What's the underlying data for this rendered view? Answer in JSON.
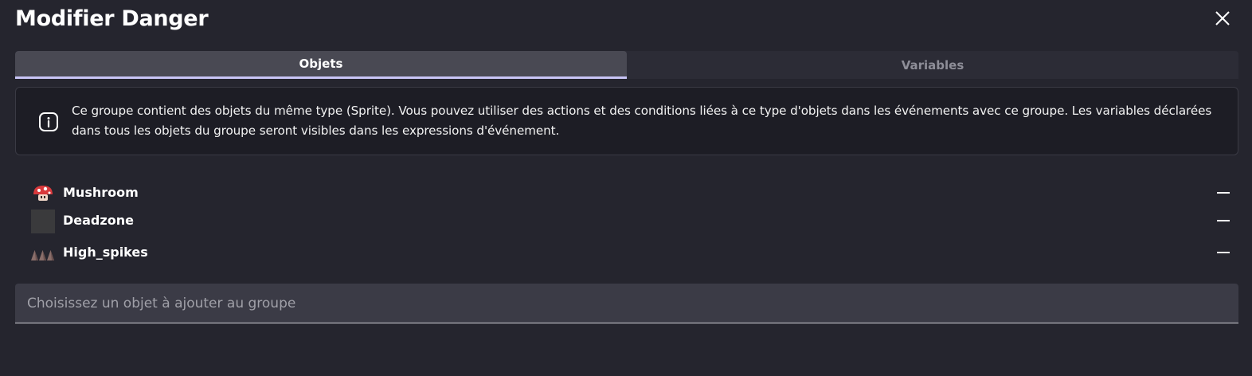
{
  "dialog": {
    "title": "Modifier Danger",
    "close_icon": "close-icon"
  },
  "tabs": [
    {
      "label": "Objets",
      "active": true
    },
    {
      "label": "Variables",
      "active": false
    }
  ],
  "info": {
    "icon": "info-icon",
    "text": "Ce groupe contient des objets du même type (Sprite). Vous pouvez utiliser des actions et des conditions liées à ce type d'objets dans les événements avec ce groupe. Les variables déclarées dans tous les objets du groupe seront visibles dans les expressions d'événement."
  },
  "objects": [
    {
      "name": "Mushroom",
      "icon": "mushroom-icon",
      "remove_icon": "remove-icon"
    },
    {
      "name": "Deadzone",
      "icon": "deadzone-icon",
      "remove_icon": "remove-icon"
    },
    {
      "name": "High_spikes",
      "icon": "spikes-icon",
      "remove_icon": "remove-icon"
    }
  ],
  "add_object": {
    "placeholder": "Choisissez un objet à ajouter au groupe",
    "value": ""
  },
  "colors": {
    "background": "#25252e",
    "tab_active": "#494953",
    "tab_indicator": "#c8c4f5",
    "info_background": "#1d1d25",
    "input_background": "#3b3b46"
  }
}
